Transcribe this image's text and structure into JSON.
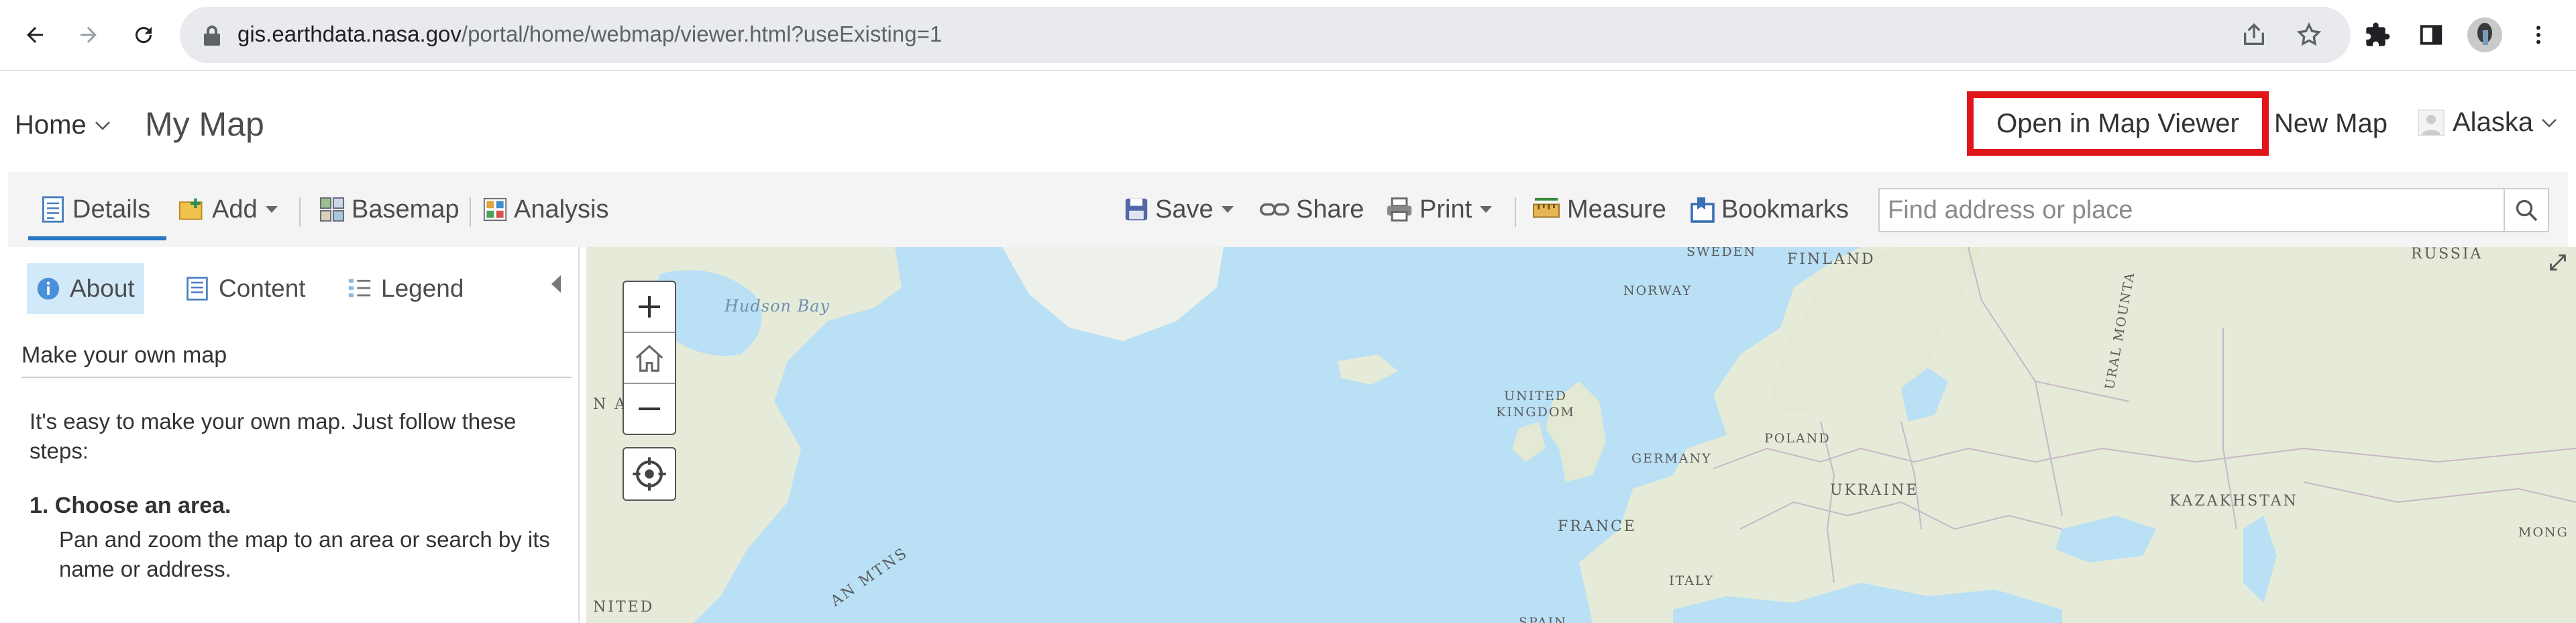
{
  "browser": {
    "url_host": "gis.earthdata.nasa.gov",
    "url_path": "/portal/home/webmap/viewer.html?useExisting=1"
  },
  "header": {
    "home_label": "Home",
    "map_title": "My Map",
    "open_viewer_label": "Open in Map Viewer",
    "new_map_label": "New Map",
    "user_name": "Alaska"
  },
  "toolbar": {
    "details": "Details",
    "add": "Add",
    "basemap": "Basemap",
    "analysis": "Analysis",
    "save": "Save",
    "share": "Share",
    "print": "Print",
    "measure": "Measure",
    "bookmarks": "Bookmarks",
    "search_placeholder": "Find address or place"
  },
  "panel": {
    "tabs": [
      "About",
      "Content",
      "Legend"
    ],
    "summary": "Make your own map",
    "intro": "It's easy to make your own map. Just follow these steps:",
    "step1_title": "1. Choose an area.",
    "step1_text": "Pan and zoom the map to an area or search by its name or address."
  },
  "map": {
    "labels": {
      "hudson_bay": "Hudson Bay",
      "sweden": "SWEDEN",
      "finland": "FINLAND",
      "russia": "RUSSIA",
      "norway": "NORWAY",
      "ural": "URAL MOUNTA",
      "united_kingdom": "UNITED KINGDOM",
      "poland": "POLAND",
      "germany": "GERMANY",
      "ukraine": "UKRAINE",
      "kazakhstan": "KAZAKHSTAN",
      "france": "FRANCE",
      "italy": "ITALY",
      "mong": "MONG",
      "an_mtns": "AN MTNS",
      "nited": "NITED",
      "n_left": "N A",
      "spain": "SPAIN"
    }
  },
  "colors": {
    "accent": "#2a77c5",
    "highlight_border": "#e0161b",
    "active_tab_bg": "#d2e9f9",
    "water": "#b9e0f4",
    "land": "#e6ebd9"
  }
}
